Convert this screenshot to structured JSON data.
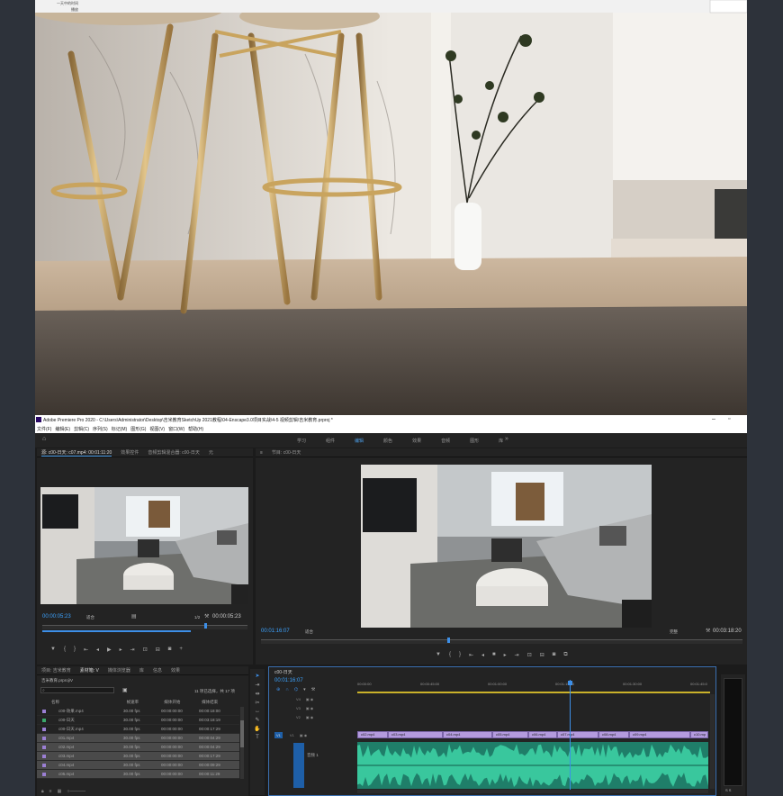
{
  "top_overlay": {
    "l1": "一天中的时间",
    "l2": "播放"
  },
  "window": {
    "title": "Adobe Premiere Pro 2020 - C:\\Users\\Administrator\\Desktop\\吉米教育SketchUp 2021教程\\04-Enscape3.0项目实战\\4-5 视频剪辑\\吉米教育.prproj *"
  },
  "menu": [
    "文件(F)",
    "编辑(E)",
    "剪辑(C)",
    "序列(S)",
    "标记(M)",
    "图形(G)",
    "视图(V)",
    "窗口(W)",
    "帮助(H)"
  ],
  "workspaces": [
    "学习",
    "组件",
    "编辑",
    "颜色",
    "效果",
    "音频",
    "图形",
    "库"
  ],
  "source": {
    "tabs": [
      "源: c00-日天: c07.mp4: 00:01:11:20",
      "效果控件",
      "音频剪辑混合器: c00-日天",
      "元"
    ],
    "timecode": "00:00:05:23",
    "fit": "适合",
    "scale": "1/2",
    "duration": "00:00:05:23"
  },
  "program": {
    "tab": "节目: c00-日天",
    "timecode": "00:01:16:07",
    "fit": "适合",
    "quality": "完整",
    "duration": "00:03:18:20"
  },
  "project": {
    "tabs": [
      "项目: 吉米教育",
      "素材箱: V",
      "媒体浏览器",
      "库",
      "信息",
      "效果"
    ],
    "file": "吉米教育.prproj\\V",
    "count": "11 项已选择，共 17 项",
    "headers": [
      "名称",
      "帧速率",
      "媒体开始",
      "媒体结束"
    ],
    "rows": [
      {
        "name": "c00-效果.mp4",
        "fps": "30.00 fps",
        "start": "00:00:00:00",
        "end": "00:00:18:00",
        "color": "#9b7fd4"
      },
      {
        "name": "c00-日天",
        "fps": "30.00 fps",
        "start": "00:00:00:00",
        "end": "00:03:18:19",
        "color": "#3aa66a"
      },
      {
        "name": "c00-日天.mp4",
        "fps": "30.00 fps",
        "start": "00:00:00:00",
        "end": "00:00:17:29",
        "color": "#9b7fd4"
      },
      {
        "name": "c01.mp4",
        "fps": "30.00 fps",
        "start": "00:00:00:00",
        "end": "00:00:04:29",
        "color": "#9b7fd4"
      },
      {
        "name": "c02.mp4",
        "fps": "30.00 fps",
        "start": "00:00:00:00",
        "end": "00:00:04:29",
        "color": "#9b7fd4"
      },
      {
        "name": "c03.mp4",
        "fps": "30.00 fps",
        "start": "00:00:00:00",
        "end": "00:00:17:29",
        "color": "#9b7fd4"
      },
      {
        "name": "c04.mp4",
        "fps": "30.00 fps",
        "start": "00:00:00:00",
        "end": "00:00:09:29",
        "color": "#9b7fd4"
      },
      {
        "name": "c05.mp4",
        "fps": "30.00 fps",
        "start": "00:00:00:00",
        "end": "00:00:11:29",
        "color": "#9b7fd4"
      }
    ]
  },
  "timeline": {
    "tab": "c00-日天",
    "timecode": "00:01:16:07",
    "ruler": [
      "00:00:00",
      "00:00:45:00",
      "00:01:00:00",
      "00:01:15:00",
      "00:01:30:00",
      "00:01:45:0"
    ],
    "tracks": [
      "V4",
      "V3",
      "V2",
      "V1",
      "A1"
    ],
    "clips": [
      "c02.mp4",
      "c03.mp4",
      "c04.mp4",
      "c05.mp4",
      "c06.mp4",
      "c07.mp4",
      "c08.mp4",
      "c09.mp4",
      "c10.mp"
    ],
    "audio_label": "音频 1"
  }
}
